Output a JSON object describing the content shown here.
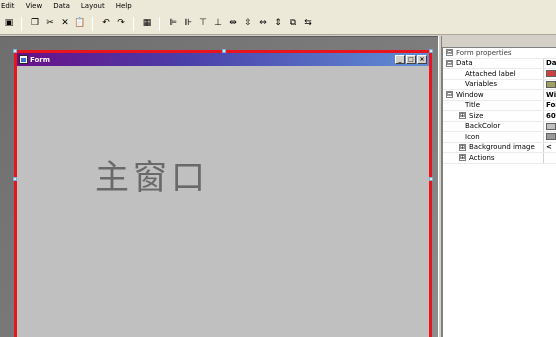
{
  "menu": [
    "Edit",
    "View",
    "Data",
    "Layout",
    "Help"
  ],
  "toolbar": {
    "icons": [
      "save-icon",
      "copy-icon",
      "cut-icon",
      "delete-icon",
      "paste-icon",
      "undo-icon",
      "redo-icon",
      "grid-icon",
      "align-left-icon",
      "align-right-icon",
      "align-top-icon",
      "align-bottom-icon",
      "center-horizontal-icon",
      "center-vertical-icon",
      "space-horizontal-icon",
      "space-vertical-icon",
      "same-size-icon",
      "tab-order-icon"
    ],
    "glyphs": [
      "▣",
      "❐",
      "✂",
      "✕",
      "📋",
      "↶",
      "↷",
      "▦",
      "⊫",
      "⊪",
      "⊤",
      "⊥",
      "⇹",
      "⇳",
      "⇔",
      "⇕",
      "⧉",
      "⇆"
    ]
  },
  "form": {
    "title": "Form",
    "label": "主窗口",
    "controls": {
      "minimize": "_",
      "maximize": "□",
      "close": "×"
    }
  },
  "properties": {
    "header": "Form properties",
    "rows": [
      {
        "label": "Data",
        "value": "Dat",
        "level": 0,
        "expander": "⊟"
      },
      {
        "label": "Attached label",
        "value": "",
        "level": 2,
        "swatch": "#d04040"
      },
      {
        "label": "Variables",
        "value": "",
        "level": 2,
        "swatch": "#a0a060"
      },
      {
        "label": "Window",
        "value": "Wi",
        "level": 0,
        "expander": "⊟"
      },
      {
        "label": "Title",
        "value": "For",
        "level": 2
      },
      {
        "label": "Size",
        "value": "60",
        "level": 1,
        "expander": "⊞"
      },
      {
        "label": "BackColor",
        "value": "",
        "level": 2,
        "swatch": "#c0c0c0"
      },
      {
        "label": "Icon",
        "value": "",
        "level": 2,
        "swatch": "#9a9a9a"
      },
      {
        "label": "Background image",
        "value": "<",
        "level": 1,
        "expander": "⊞"
      },
      {
        "label": "Actions",
        "value": "",
        "level": 1,
        "expander": "⊞"
      }
    ]
  }
}
